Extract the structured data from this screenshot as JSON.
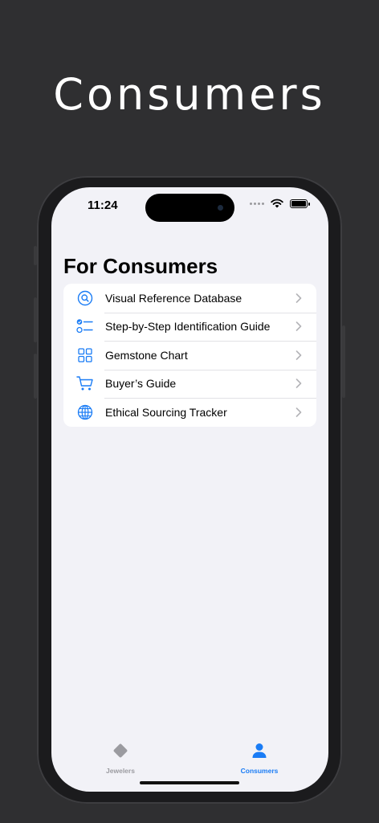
{
  "headline": "Consumers",
  "status": {
    "time": "11:24"
  },
  "page": {
    "title": "For Consumers"
  },
  "menu": [
    {
      "label": "Visual Reference Database",
      "icon": "magnifier-circle-icon"
    },
    {
      "label": "Step-by-Step Identification Guide",
      "icon": "checklist-icon"
    },
    {
      "label": "Gemstone Chart",
      "icon": "grid-icon"
    },
    {
      "label": "Buyer’s Guide",
      "icon": "cart-icon"
    },
    {
      "label": "Ethical Sourcing Tracker",
      "icon": "globe-icon"
    }
  ],
  "tabs": [
    {
      "label": "Jewelers",
      "icon": "diamond-icon",
      "selected": false
    },
    {
      "label": "Consumers",
      "icon": "person-icon",
      "selected": true
    }
  ],
  "colors": {
    "accent": "#1a7cf5",
    "inactive": "#9b9ba0",
    "background": "#f2f2f7"
  }
}
